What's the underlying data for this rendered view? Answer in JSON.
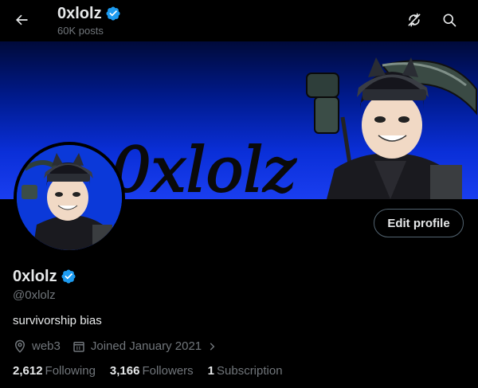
{
  "header": {
    "name": "0xlolz",
    "posts": "60K posts"
  },
  "banner": {
    "wordmark": "0xlolz"
  },
  "profile": {
    "display_name": "0xlolz",
    "handle": "@0xlolz",
    "bio": "survivorship bias",
    "edit_label": "Edit profile",
    "location": "web3",
    "joined": "Joined January 2021"
  },
  "stats": {
    "following_count": "2,612",
    "following_label": "Following",
    "followers_count": "3,166",
    "followers_label": "Followers",
    "subscription_count": "1",
    "subscription_label": "Subscription"
  },
  "colors": {
    "background": "#000000",
    "text_primary": "#e7e9ea",
    "text_secondary": "#71767b",
    "verified": "#1d9bf0",
    "banner_blue": "#0a2fd8"
  },
  "icons": [
    "back-arrow-icon",
    "verified-icon",
    "refresh-icon",
    "search-icon",
    "location-icon",
    "calendar-icon",
    "chevron-right-icon"
  ]
}
